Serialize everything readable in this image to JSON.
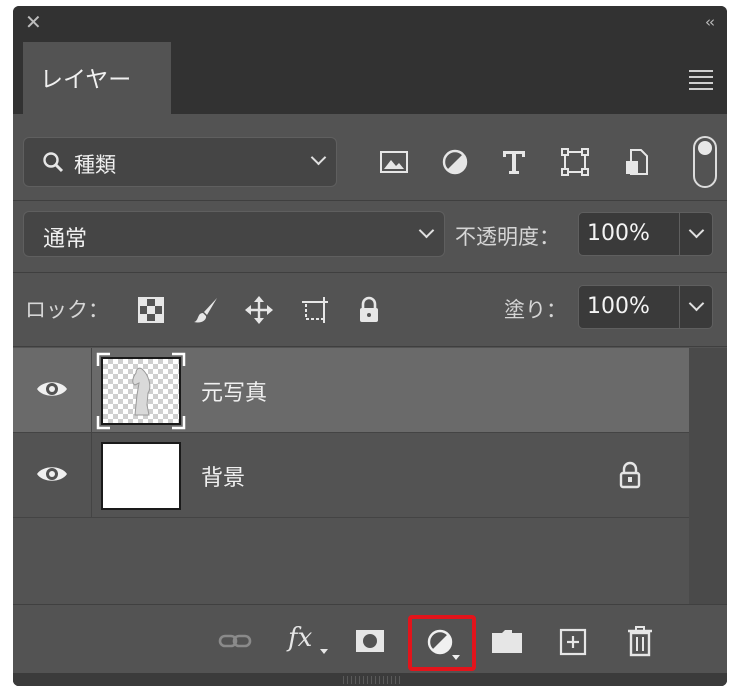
{
  "panel": {
    "tab_label": "レイヤー",
    "close_icon": "close-icon",
    "collapse_icon": "double-chevron-left-icon",
    "menu_icon": "panel-menu-icon"
  },
  "filter": {
    "kind_label": "種類",
    "icons": [
      "image-filter-icon",
      "adjustment-filter-icon",
      "type-filter-icon",
      "shape-filter-icon",
      "smart-object-filter-icon"
    ],
    "toggle": "filter-toggle"
  },
  "blend": {
    "mode": "通常",
    "opacity_label": "不透明度：",
    "opacity_value": "100%"
  },
  "lock": {
    "label": "ロック：",
    "icons": [
      "lock-transparent-icon",
      "lock-image-icon",
      "lock-position-icon",
      "lock-artboard-icon",
      "lock-all-icon"
    ],
    "fill_label": "塗り：",
    "fill_value": "100%"
  },
  "layers": [
    {
      "name": "元写真",
      "visible": true,
      "selected": true,
      "locked": false
    },
    {
      "name": "背景",
      "visible": true,
      "selected": false,
      "locked": true
    }
  ],
  "bottom_toolbar": {
    "items": [
      "link-layers-icon",
      "fx-icon",
      "layer-mask-icon",
      "adjustment-layer-icon",
      "group-folder-icon",
      "new-layer-icon",
      "trash-icon"
    ],
    "fx_label": "fx",
    "highlighted": "adjustment-layer-icon",
    "highlight_color": "#e3141b"
  }
}
